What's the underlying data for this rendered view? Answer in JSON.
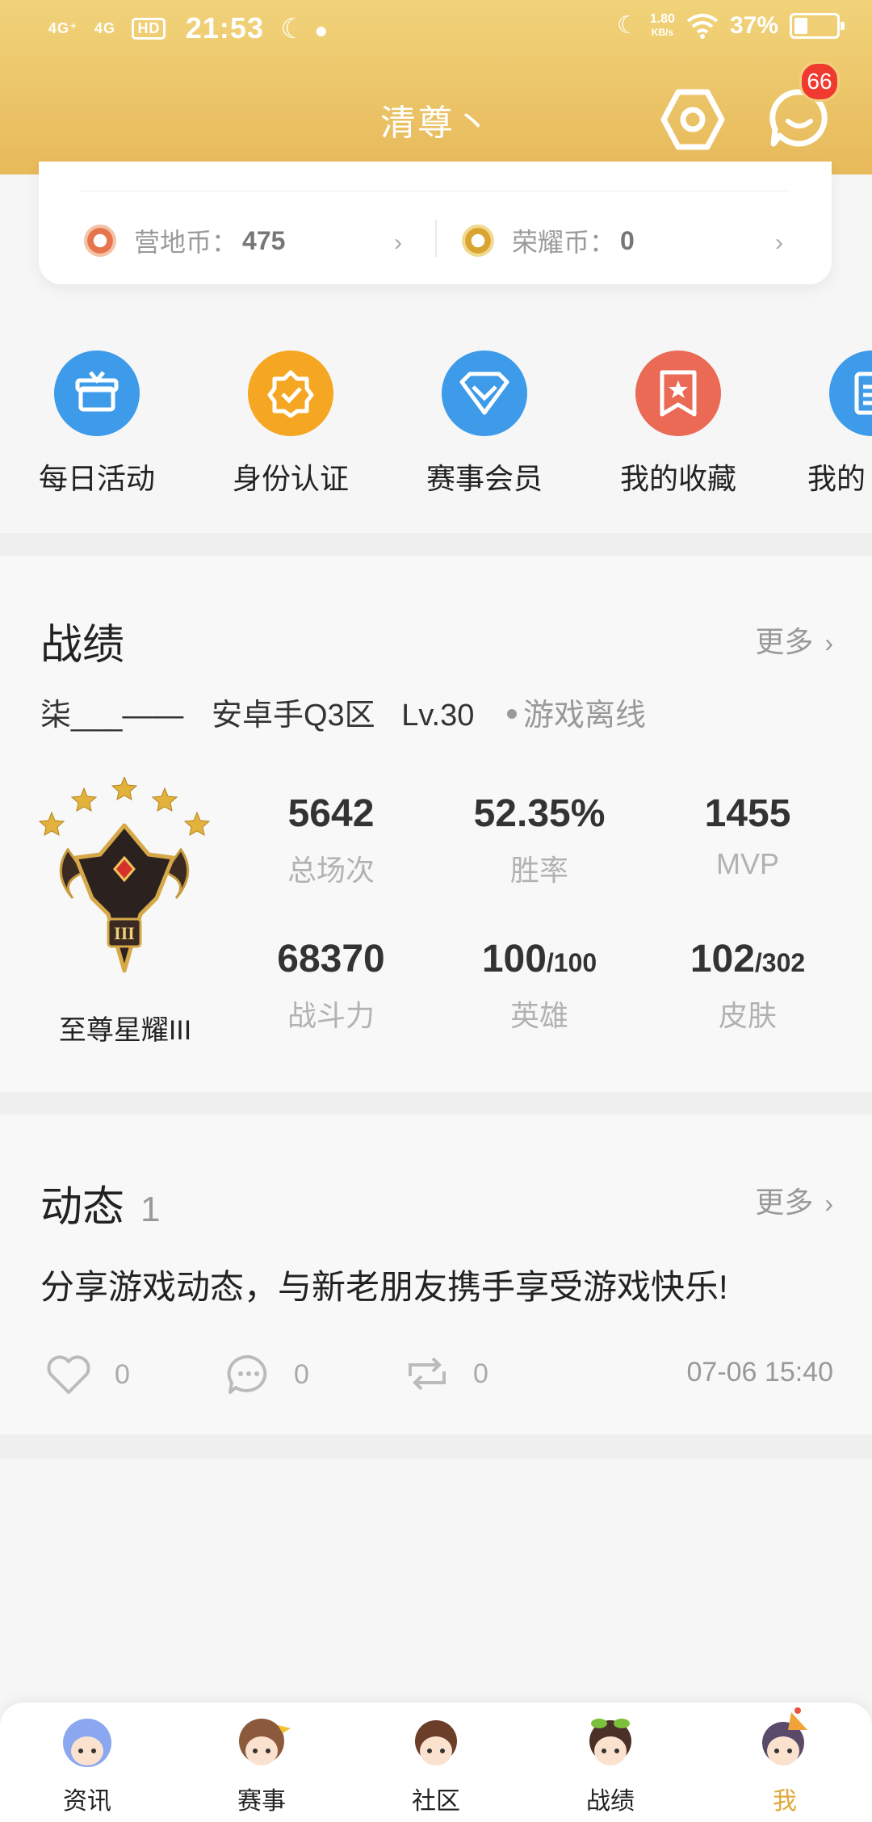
{
  "status_bar": {
    "network1": "4G⁺",
    "network2": "4G",
    "hd": "HD",
    "time": "21:53",
    "speed_value": "1.80",
    "speed_unit": "KB/s",
    "battery": "37%",
    "battery_level": 0.37
  },
  "header": {
    "nickname": "清尊丶",
    "settings_icon": "hexagon-gear-icon",
    "message_icon": "chat-bubble-icon",
    "message_badge": "66"
  },
  "coins": {
    "camp_label": "营地币：",
    "camp_value": "475",
    "glory_label": "荣耀币：",
    "glory_value": "0"
  },
  "shortcuts": [
    {
      "label": "每日活动",
      "icon": "gift-icon",
      "color": "#3d9be9"
    },
    {
      "label": "身份认证",
      "icon": "verified-badge-icon",
      "color": "#f5a623"
    },
    {
      "label": "赛事会员",
      "icon": "diamond-icon",
      "color": "#3d9be9"
    },
    {
      "label": "我的收藏",
      "icon": "bookmark-star-icon",
      "color": "#ea6a56"
    },
    {
      "label": "我的",
      "icon": "document-icon",
      "color": "#3d9be9"
    }
  ],
  "battle": {
    "title": "战绩",
    "more": "更多",
    "player_name": "柒___——",
    "server": "安卓手Q3区",
    "level": "Lv.30",
    "status": "游戏离线",
    "rank_name": "至尊星耀III",
    "rank_stars": 5,
    "stats": {
      "matches": {
        "value": "5642",
        "label": "总场次"
      },
      "win_rate": {
        "value": "52.35%",
        "label": "胜率"
      },
      "mvp": {
        "value": "1455",
        "label": "MVP"
      },
      "power": {
        "value": "68370",
        "label": "战斗力"
      },
      "heroes": {
        "value": "100",
        "total": "/100",
        "label": "英雄"
      },
      "skins": {
        "value": "102",
        "total": "/302",
        "label": "皮肤"
      }
    }
  },
  "feed": {
    "title": "动态",
    "count": "1",
    "more": "更多",
    "text": "分享游戏动态，与新老朋友携手享受游戏快乐!",
    "likes": "0",
    "comments": "0",
    "reposts": "0",
    "time": "07-06 15:40"
  },
  "bottom_nav": [
    {
      "label": "资讯",
      "active": false
    },
    {
      "label": "赛事",
      "active": false
    },
    {
      "label": "社区",
      "active": false
    },
    {
      "label": "战绩",
      "active": false
    },
    {
      "label": "我",
      "active": true
    }
  ],
  "colors": {
    "header_gradient_top": "#f1d37a",
    "header_gradient_bottom": "#e7b95a",
    "badge": "#f03a2f",
    "active_tab": "#e0a93a"
  }
}
